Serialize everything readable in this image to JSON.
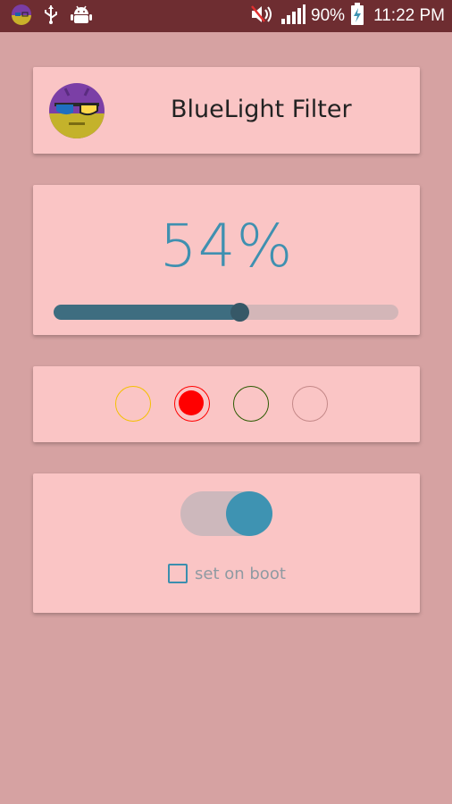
{
  "status_bar": {
    "battery_text": "90%",
    "time": "11:22 PM",
    "icons": [
      "app-notification-icon",
      "usb-icon",
      "android-debug-icon",
      "volume-muted-icon",
      "signal-icon",
      "battery-charging-icon"
    ]
  },
  "header": {
    "title": "BlueLight Filter",
    "icon": "bluelight-filter-app-icon"
  },
  "intensity": {
    "percent_text": "54%",
    "value_fraction": 0.54
  },
  "color_options": [
    {
      "name": "yellow",
      "color": "#f4c000",
      "selected": false
    },
    {
      "name": "red",
      "color": "#ff0000",
      "selected": true
    },
    {
      "name": "green",
      "color": "#2b5a00",
      "selected": false
    },
    {
      "name": "none",
      "color": "#c48888",
      "selected": false
    }
  ],
  "toggle": {
    "enabled": true,
    "on_color": "#3e93b2",
    "track_color": "#cdb8bc"
  },
  "boot": {
    "label": "set on boot",
    "checked": false
  },
  "colors": {
    "background": "#d6a2a2",
    "card": "#fac5c5",
    "accent": "#3f90b0",
    "statusbar": "#6e2d31"
  }
}
